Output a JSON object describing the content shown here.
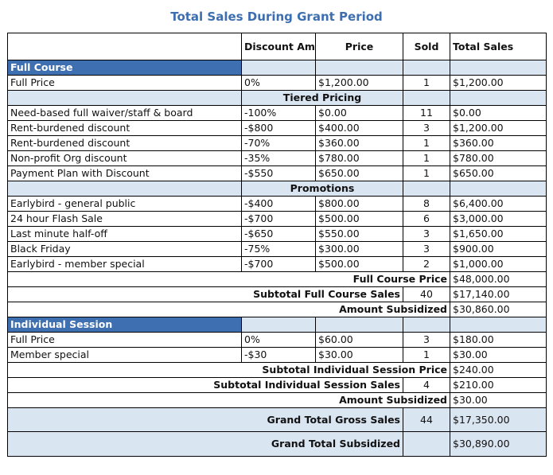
{
  "title": "Total Sales During Grant Period",
  "headers": {
    "item": "",
    "discount": "Discount Amount",
    "price": "Price",
    "sold": "Sold",
    "total": "Total Sales"
  },
  "full_course": {
    "section_label": "Full Course",
    "full_price": {
      "item": "Full Price",
      "discount": "0%",
      "price": "$1,200.00",
      "sold": "1",
      "total": "$1,200.00"
    },
    "tiered_label": "Tiered Pricing",
    "tiered": [
      {
        "item": "Need-based full waiver/staff & board",
        "discount": "-100%",
        "price": "$0.00",
        "sold": "11",
        "total": "$0.00"
      },
      {
        "item": "Rent-burdened discount",
        "discount": "-$800",
        "price": "$400.00",
        "sold": "3",
        "total": "$1,200.00"
      },
      {
        "item": "Rent-burdened discount",
        "discount": "-70%",
        "price": "$360.00",
        "sold": "1",
        "total": "$360.00"
      },
      {
        "item": "Non-profit Org discount",
        "discount": "-35%",
        "price": "$780.00",
        "sold": "1",
        "total": "$780.00"
      },
      {
        "item": "Payment Plan with Discount",
        "discount": "-$550",
        "price": "$650.00",
        "sold": "1",
        "total": "$650.00"
      }
    ],
    "promotions_label": "Promotions",
    "promotions": [
      {
        "item": "Earlybird - general public",
        "discount": "-$400",
        "price": "$800.00",
        "sold": "8",
        "total": "$6,400.00"
      },
      {
        "item": "24 hour Flash Sale",
        "discount": "-$700",
        "price": "$500.00",
        "sold": "6",
        "total": "$3,000.00"
      },
      {
        "item": "Last minute half-off",
        "discount": "-$650",
        "price": "$550.00",
        "sold": "3",
        "total": "$1,650.00"
      },
      {
        "item": "Black Friday",
        "discount": "-75%",
        "price": "$300.00",
        "sold": "3",
        "total": "$900.00"
      },
      {
        "item": "Earlybird - member special",
        "discount": "-$700",
        "price": "$500.00",
        "sold": "2",
        "total": "$1,000.00"
      }
    ],
    "full_course_price": {
      "label": "Full Course Price",
      "total": "$48,000.00"
    },
    "subtotal_sales": {
      "label": "Subtotal Full Course Sales",
      "sold": "40",
      "total": "$17,140.00"
    },
    "amount_subsidized": {
      "label": "Amount Subsidized",
      "total": "$30,860.00"
    }
  },
  "individual_session": {
    "section_label": "Individual Session",
    "rows": [
      {
        "item": "Full Price",
        "discount": "0%",
        "price": "$60.00",
        "sold": "3",
        "total": "$180.00"
      },
      {
        "item": "Member special",
        "discount": "-$30",
        "price": "$30.00",
        "sold": "1",
        "total": "$30.00"
      }
    ],
    "subtotal_price": {
      "label": "Subtotal Individual Session Price",
      "total": "$240.00"
    },
    "subtotal_sales": {
      "label": "Subtotal Individual Session Sales",
      "sold": "4",
      "total": "$210.00"
    },
    "amount_subsidized": {
      "label": "Amount Subsidized",
      "total": "$30.00"
    }
  },
  "grand_total_gross": {
    "label": "Grand Total Gross Sales",
    "sold": "44",
    "total": "$17,350.00"
  },
  "grand_total_subsidized": {
    "label": "Grand Total Subsidized",
    "total": "$30,890.00"
  },
  "colors": {
    "title": "#3d6fb0",
    "section_header": "#3e6fb0",
    "subsection": "#dae5f2"
  }
}
